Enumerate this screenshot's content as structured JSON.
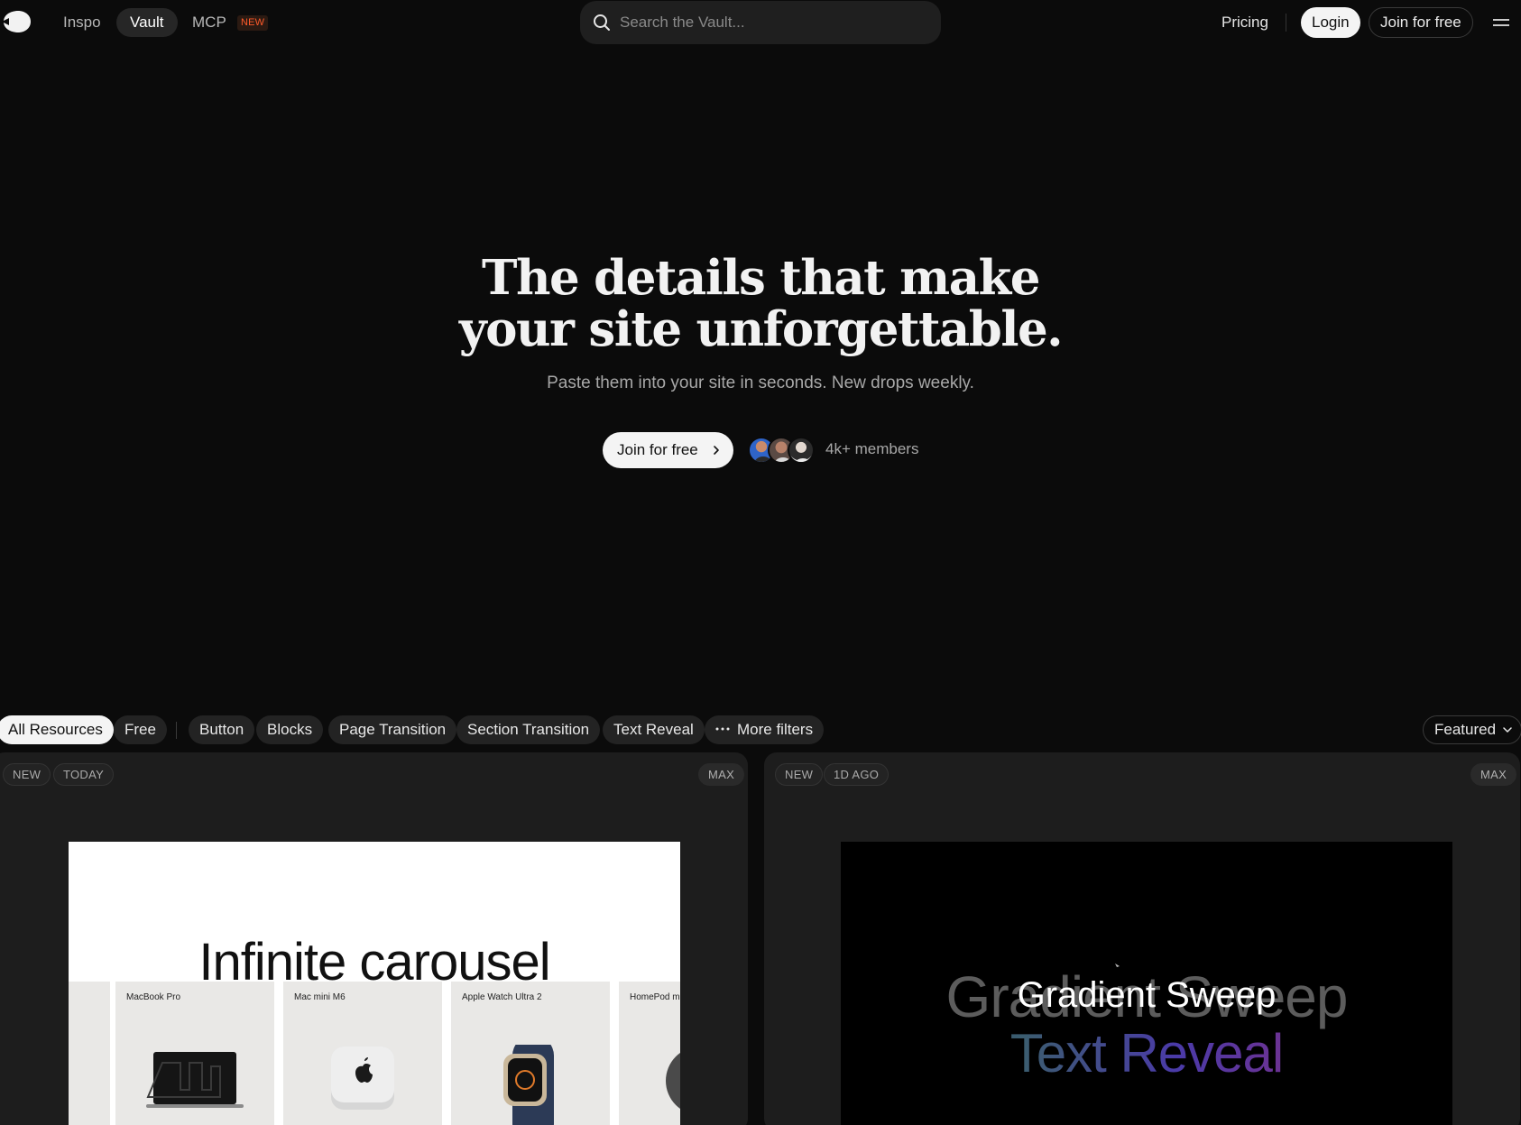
{
  "nav": {
    "inspo": "Inspo",
    "vault": "Vault",
    "mcp": "MCP",
    "mcp_badge": "NEW",
    "search_placeholder": "Search the Vault...",
    "pricing": "Pricing",
    "login": "Login",
    "join": "Join for free"
  },
  "hero": {
    "title_line1": "The details that make",
    "title_line2": "your site unforgettable.",
    "subtitle": "Paste them into your site in seconds. New drops weekly.",
    "cta": "Join for free",
    "members": "4k+ members"
  },
  "filters": {
    "items": [
      "All Resources",
      "Free",
      "Button",
      "Blocks",
      "Page Transition",
      "Section Transition",
      "Text Reveal",
      "More filters"
    ],
    "active": "All Resources",
    "sort": "Featured"
  },
  "cards": [
    {
      "tags": [
        "NEW",
        "TODAY"
      ],
      "tier": "MAX",
      "preview_title": "Infinite carousel",
      "products": [
        "MacBook Pro",
        "Mac mini M6",
        "Apple Watch Ultra 2",
        "HomePod mini"
      ]
    },
    {
      "tags": [
        "NEW",
        "1D AGO"
      ],
      "tier": "MAX",
      "preview_back": "Gradient Sweep",
      "preview_front": "Gradient Sweep",
      "preview_line2": "Text Reveal"
    }
  ],
  "colors": {
    "background": "#0b0b0b",
    "card": "#1d1d1d",
    "chip": "#232323",
    "badge_accent": "#ff5a2a",
    "light_button": "#f4f4f4"
  },
  "icons": [
    "logo-icon",
    "search-icon",
    "menu-icon",
    "chevron-right-icon",
    "more-dots-icon",
    "chevron-down-icon"
  ]
}
